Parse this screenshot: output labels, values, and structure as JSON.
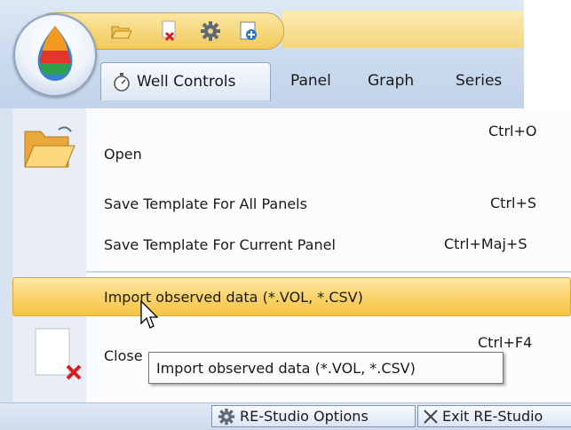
{
  "ribbon": {
    "qat": {
      "icons": [
        "open-folder-icon",
        "close-file-icon",
        "gear-icon",
        "new-document-icon"
      ]
    },
    "tabs": [
      {
        "label": "Well Controls",
        "icon": "stopwatch-icon"
      },
      {
        "label": "Panel"
      },
      {
        "label": "Graph"
      },
      {
        "label": "Series"
      }
    ]
  },
  "menu": {
    "items": [
      {
        "label": "Open",
        "shortcut": "Ctrl+O",
        "icon": "open-folder-icon"
      },
      {
        "label": "Save Template For All Panels",
        "shortcut": "Ctrl+S"
      },
      {
        "label": "Save Template For Current Panel",
        "shortcut": "Ctrl+Maj+S"
      },
      {
        "label": "Import observed data (*.VOL, *.CSV)",
        "highlighted": true
      },
      {
        "label": "Close",
        "shortcut": "Ctrl+F4",
        "icon": "close-document-icon"
      }
    ]
  },
  "tooltip": {
    "text": "Import observed data (*.VOL, *.CSV)"
  },
  "footer": {
    "options_label": "RE-Studio Options",
    "exit_label": "Exit RE-Studio"
  },
  "colors": {
    "highlight": "#f9d36c",
    "ribbon": "#cddcee",
    "accent_red": "#d81e1e"
  }
}
